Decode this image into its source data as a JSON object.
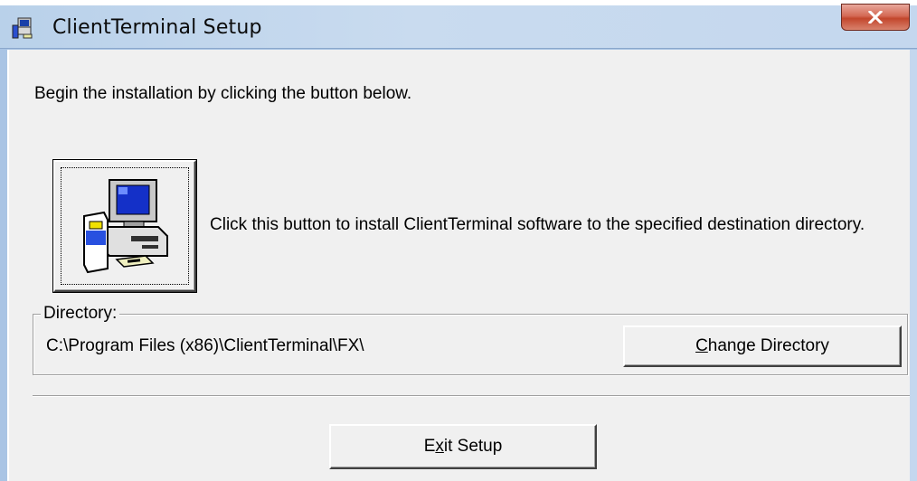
{
  "window": {
    "title": "ClientTerminal Setup",
    "close_symbol": "X"
  },
  "content": {
    "intro_text": "Begin the installation by clicking the button below.",
    "install_description": "Click this button to install ClientTerminal software to the specified destination directory.",
    "directory_label": "Directory:",
    "directory_path": "C:\\Program Files (x86)\\ClientTerminal\\FX\\"
  },
  "buttons": {
    "change_directory": {
      "mnemonic": "C",
      "rest": "hange Directory"
    },
    "exit_setup": {
      "before": "E",
      "mnemonic": "x",
      "after": "it Setup"
    }
  },
  "icons": {
    "title": "setup-computer-icon",
    "install": "install-computer-icon",
    "close": "close-icon"
  }
}
